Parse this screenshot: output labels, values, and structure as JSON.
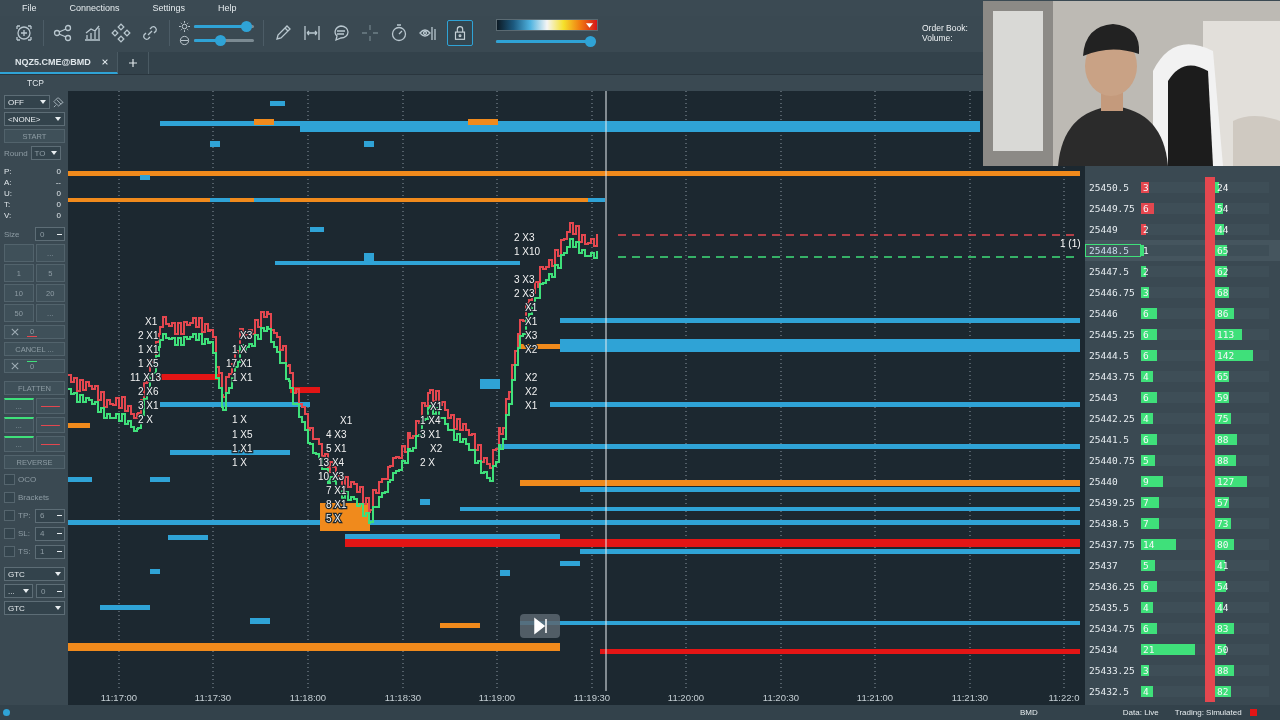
{
  "menu": [
    "File",
    "Connections",
    "Settings",
    "Help"
  ],
  "toolbar": {
    "brightness": {
      "level": 0.95
    },
    "contrast": {
      "level": 0.42
    },
    "color_range": {
      "level": 1.0
    },
    "lock": {
      "selected": true
    },
    "order_book_label": "Order Book:",
    "volume_label": "Volume:"
  },
  "tabs": [
    {
      "label": "NQZ5.CME@BMD",
      "selected": true
    }
  ],
  "connection_label": "TCP",
  "left_panel": {
    "mode": "OFF",
    "strategy": "<NONE>",
    "start": "START",
    "round": {
      "label": "Round",
      "value": "TO"
    },
    "stats": [
      {
        "label": "P:",
        "value": "0"
      },
      {
        "label": "A:",
        "value": "--"
      },
      {
        "label": "U:",
        "value": "0"
      },
      {
        "label": "T:",
        "value": "0"
      },
      {
        "label": "V:",
        "value": "0"
      }
    ],
    "size": {
      "label": "Size",
      "value": "0"
    },
    "quantity_buttons": [
      "...",
      "1",
      "5",
      "10",
      "20",
      "50",
      "..."
    ],
    "buy_cancel": "0",
    "cancel": "CANCEL ...",
    "sell_cancel": "0",
    "flatten": "FLATTEN",
    "order_pairs": [
      "...",
      "...",
      "..."
    ],
    "reverse": "REVERSE",
    "checks": [
      {
        "label": "OCO",
        "checked": false
      },
      {
        "label": "Brackets",
        "checked": false
      }
    ],
    "brackets": [
      {
        "label": "TP:",
        "value": "6",
        "checked": false
      },
      {
        "label": "SL:",
        "value": "4",
        "checked": false
      },
      {
        "label": "TS:",
        "value": "1",
        "checked": false
      }
    ],
    "tif": "GTC",
    "sub_select": "...",
    "sub_value": "0",
    "tif2": "GTC"
  },
  "chart": {
    "trade_labels": [
      "X1",
      "2 X1",
      "1 X1",
      "1 X5",
      "11 X13",
      "2 X6",
      "3 X1",
      "2 X",
      "X3",
      "1 X",
      "17 X1",
      "1 X1",
      "1 X",
      "1 X5",
      "1 X1",
      "1 X",
      "X1",
      "4 X3",
      "5 X1",
      "13 X4",
      "10 X3",
      "7 X1",
      "8 X1",
      "5 X",
      "X1",
      "1 X4",
      "3 X1",
      "X2",
      "2 X",
      "2 X3",
      "1 X10",
      "3 X3",
      "2 X3",
      "X1",
      "X1",
      "X3",
      "X2",
      "X2",
      "X2",
      "X1"
    ],
    "position_label": "1 (1)",
    "time_labels": [
      "11:17:00",
      "11:17:30",
      "11:18:00",
      "11:18:30",
      "11:19:00",
      "11:19:30",
      "11:20:00",
      "11:20:30",
      "11:21:00",
      "11:21:30",
      "11:22:0"
    ]
  },
  "ladder": [
    {
      "price": "25450.5",
      "ask": true,
      "current": false,
      "volume": {
        "text": "3",
        "level": 0.12
      },
      "session": {
        "text": "24",
        "level": 0.08
      }
    },
    {
      "price": "25449.75",
      "ask": true,
      "current": false,
      "volume": {
        "text": "6",
        "level": 0.2
      },
      "session": {
        "text": "54",
        "level": 0.15
      }
    },
    {
      "price": "25449",
      "ask": true,
      "current": false,
      "volume": {
        "text": "2",
        "level": 0.08
      },
      "session": {
        "text": "44",
        "level": 0.16
      }
    },
    {
      "price": "25448.5",
      "ask": false,
      "current": true,
      "volume": {
        "text": "1",
        "level": 0.05
      },
      "session": {
        "text": "65",
        "level": 0.22
      }
    },
    {
      "price": "25447.5",
      "ask": false,
      "current": false,
      "volume": {
        "text": "2",
        "level": 0.08
      },
      "session": {
        "text": "62",
        "level": 0.22
      }
    },
    {
      "price": "25446.75",
      "ask": false,
      "current": false,
      "volume": {
        "text": "3",
        "level": 0.12
      },
      "session": {
        "text": "68",
        "level": 0.25
      }
    },
    {
      "price": "25446",
      "ask": false,
      "current": false,
      "volume": {
        "text": "6",
        "level": 0.25
      },
      "session": {
        "text": "86",
        "level": 0.35
      }
    },
    {
      "price": "25445.25",
      "ask": false,
      "current": false,
      "volume": {
        "text": "6",
        "level": 0.25
      },
      "session": {
        "text": "113",
        "level": 0.5
      }
    },
    {
      "price": "25444.5",
      "ask": false,
      "current": false,
      "volume": {
        "text": "6",
        "level": 0.25
      },
      "session": {
        "text": "142",
        "level": 0.7
      }
    },
    {
      "price": "25443.75",
      "ask": false,
      "current": false,
      "volume": {
        "text": "4",
        "level": 0.18
      },
      "session": {
        "text": "65",
        "level": 0.25
      }
    },
    {
      "price": "25443",
      "ask": false,
      "current": false,
      "volume": {
        "text": "6",
        "level": 0.25
      },
      "session": {
        "text": "59",
        "level": 0.25
      }
    },
    {
      "price": "25442.25",
      "ask": false,
      "current": false,
      "volume": {
        "text": "4",
        "level": 0.18
      },
      "session": {
        "text": "75",
        "level": 0.3
      }
    },
    {
      "price": "25441.5",
      "ask": false,
      "current": false,
      "volume": {
        "text": "6",
        "level": 0.25
      },
      "session": {
        "text": "88",
        "level": 0.4
      }
    },
    {
      "price": "25440.75",
      "ask": false,
      "current": false,
      "volume": {
        "text": "5",
        "level": 0.22
      },
      "session": {
        "text": "88",
        "level": 0.38
      }
    },
    {
      "price": "25440",
      "ask": false,
      "current": false,
      "volume": {
        "text": "9",
        "level": 0.35
      },
      "session": {
        "text": "127",
        "level": 0.6
      }
    },
    {
      "price": "25439.25",
      "ask": false,
      "current": false,
      "volume": {
        "text": "7",
        "level": 0.28
      },
      "session": {
        "text": "57",
        "level": 0.25
      }
    },
    {
      "price": "25438.5",
      "ask": false,
      "current": false,
      "volume": {
        "text": "7",
        "level": 0.28
      },
      "session": {
        "text": "73",
        "level": 0.3
      }
    },
    {
      "price": "25437.75",
      "ask": false,
      "current": false,
      "volume": {
        "text": "14",
        "level": 0.55
      },
      "session": {
        "text": "80",
        "level": 0.35
      }
    },
    {
      "price": "25437",
      "ask": false,
      "current": false,
      "volume": {
        "text": "5",
        "level": 0.22
      },
      "session": {
        "text": "41",
        "level": 0.18
      }
    },
    {
      "price": "25436.25",
      "ask": false,
      "current": false,
      "volume": {
        "text": "6",
        "level": 0.25
      },
      "session": {
        "text": "54",
        "level": 0.2
      }
    },
    {
      "price": "25435.5",
      "ask": false,
      "current": false,
      "volume": {
        "text": "4",
        "level": 0.18
      },
      "session": {
        "text": "44",
        "level": 0.15
      }
    },
    {
      "price": "25434.75",
      "ask": false,
      "current": false,
      "volume": {
        "text": "6",
        "level": 0.25
      },
      "session": {
        "text": "83",
        "level": 0.35
      }
    },
    {
      "price": "25434",
      "ask": false,
      "current": false,
      "volume": {
        "text": "21",
        "level": 0.85
      },
      "session": {
        "text": "50",
        "level": 0.2
      }
    },
    {
      "price": "25433.25",
      "ask": false,
      "current": false,
      "volume": {
        "text": "3",
        "level": 0.12
      },
      "session": {
        "text": "88",
        "level": 0.35
      }
    },
    {
      "price": "25432.5",
      "ask": false,
      "current": false,
      "volume": {
        "text": "4",
        "level": 0.18
      },
      "session": {
        "text": "82",
        "level": 0.3
      }
    }
  ],
  "status_bar": {
    "broker": "BMD",
    "data": "Data: Live",
    "trading": "Trading: Simulated"
  }
}
